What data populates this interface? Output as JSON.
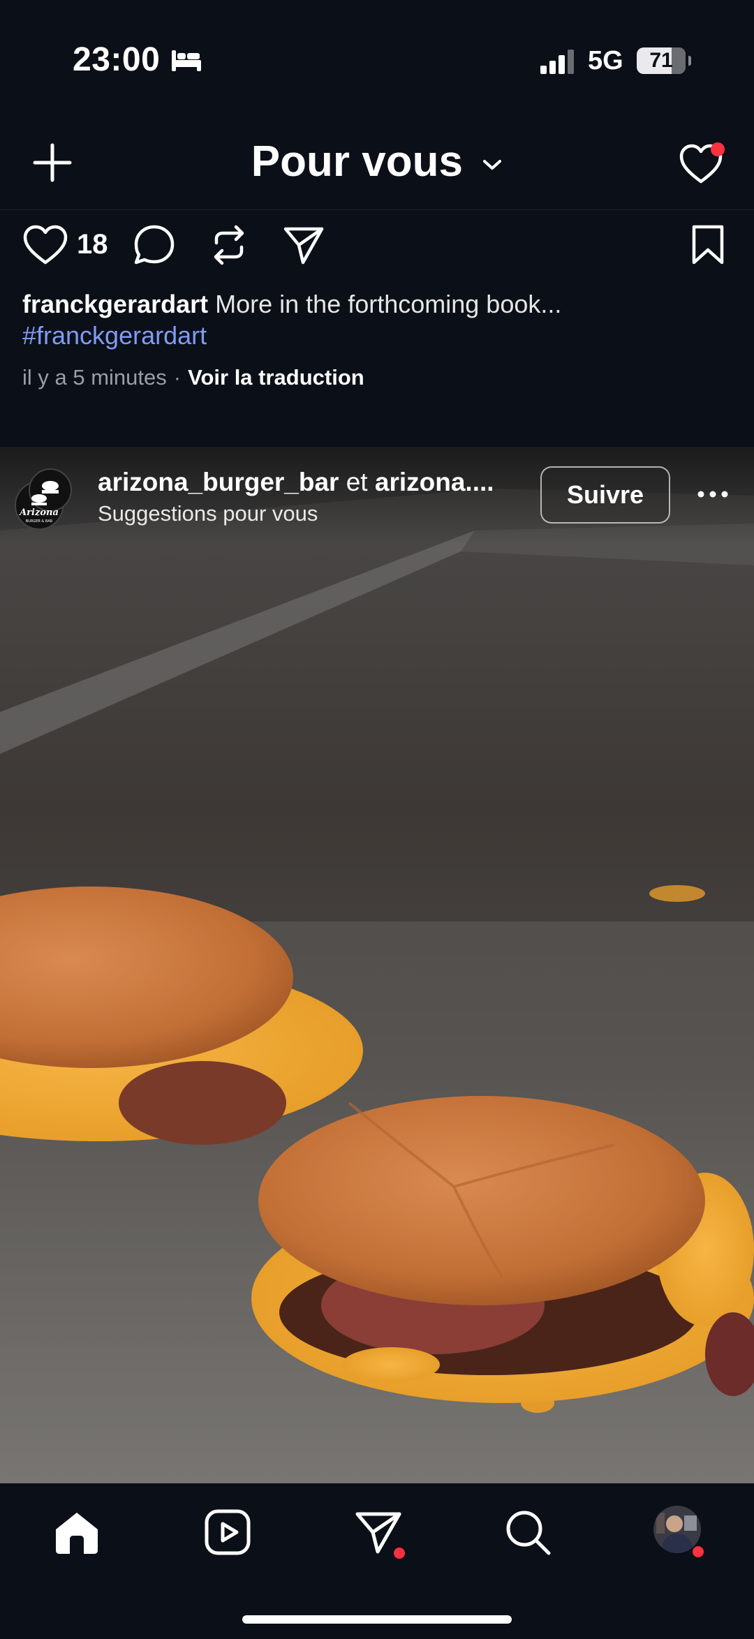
{
  "status_bar": {
    "time": "23:00",
    "network": "5G",
    "battery": "71",
    "icons": [
      "bed-icon",
      "signal-bars-icon",
      "battery-icon"
    ]
  },
  "header": {
    "title": "Pour vous",
    "icons": [
      "plus-icon",
      "chevron-down-icon",
      "heart-icon"
    ]
  },
  "previous_post": {
    "like_count": "18",
    "username": "franckgerardart",
    "caption": " More in the forthcoming book...",
    "hashtag": "#franckgerardart",
    "time_ago": "il y a 5 minutes",
    "separator": "·",
    "translate_label": "Voir la traduction",
    "icons": [
      "heart-icon",
      "comment-icon",
      "repost-icon",
      "send-icon",
      "bookmark-icon"
    ]
  },
  "current_post": {
    "user_primary": "arizona_burger_bar",
    "connector": " et ",
    "user_secondary": "arizona....",
    "subtitle": "Suggestions pour vous",
    "follow_label": "Suivre",
    "logo_text": "Arizona",
    "logo_subtext": "BURGER & BAR",
    "icons": [
      "more-icon"
    ]
  },
  "bottom_nav": {
    "items": [
      "home-icon",
      "reels-icon",
      "send-icon",
      "search-icon",
      "profile-avatar"
    ]
  },
  "colors": {
    "background": "#0b0f17",
    "hashtag": "#7f9cf5",
    "notification": "#ff3040"
  }
}
